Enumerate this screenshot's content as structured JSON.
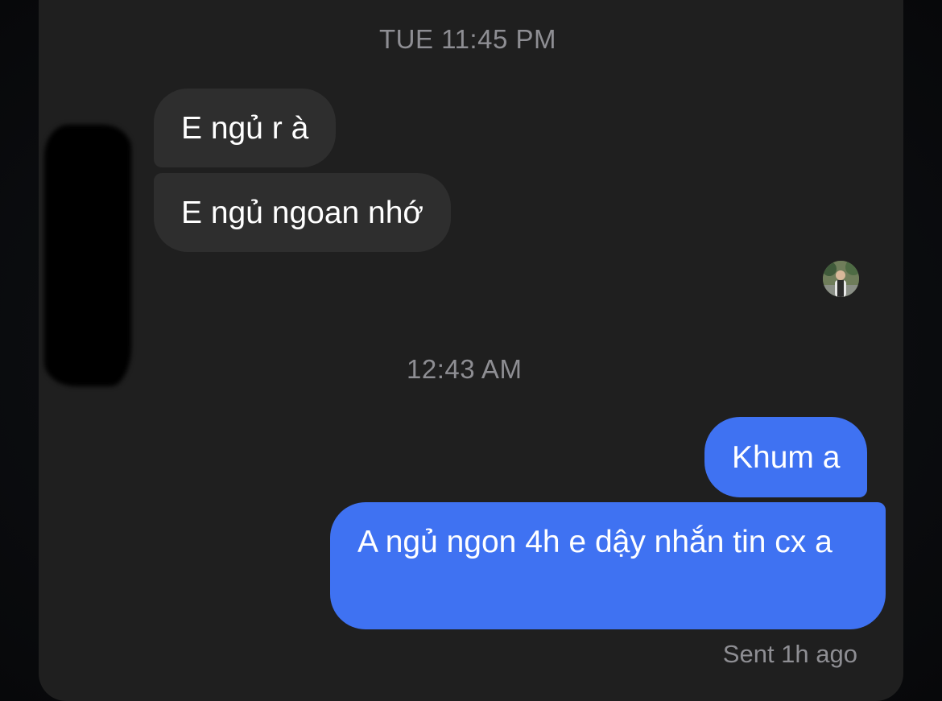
{
  "conversation": {
    "timestamps": [
      "TUE 11:45 PM",
      "12:43 AM"
    ],
    "incoming_messages": [
      "E ngủ r à",
      "E ngủ ngoan nhớ"
    ],
    "outgoing_messages": [
      "Khum a",
      "A ngủ ngon 4h e dậy nhắn tin cx a"
    ],
    "status": "Sent 1h ago"
  },
  "colors": {
    "background": "#1f1f1f",
    "incoming_bubble": "#2e2e2e",
    "outgoing_bubble": "#3f72f2",
    "meta_text": "#8e8e93"
  },
  "icons": {
    "read_receipt": "avatar-photo"
  }
}
